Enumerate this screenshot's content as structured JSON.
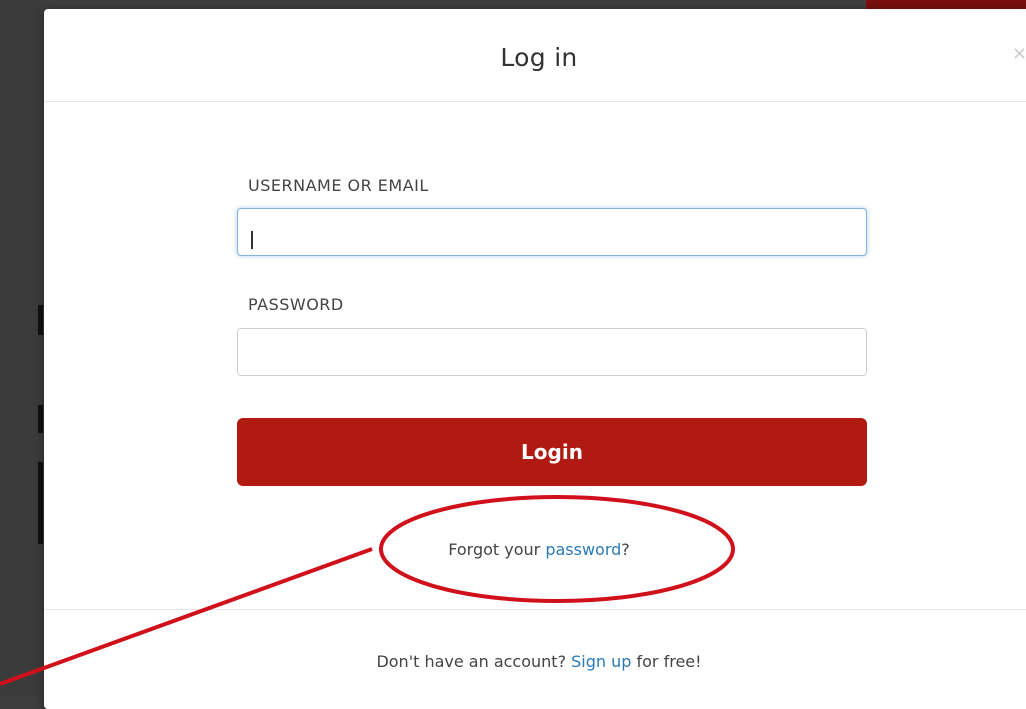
{
  "modal": {
    "title": "Log in",
    "close_icon": "×"
  },
  "form": {
    "username_label": "USERNAME OR EMAIL",
    "username_value": "",
    "password_label": "PASSWORD",
    "password_value": "",
    "login_button": "Login"
  },
  "forgot": {
    "prefix": "Forgot your ",
    "link": "password",
    "suffix": "?"
  },
  "footer": {
    "prefix": "Don't have an account? ",
    "link": "Sign up",
    "suffix": " for free!"
  },
  "colors": {
    "accent_red": "#b01a10",
    "link_blue": "#2a7ab8",
    "annotation_red": "#d0101a"
  },
  "icons": {
    "close": "close-icon"
  }
}
